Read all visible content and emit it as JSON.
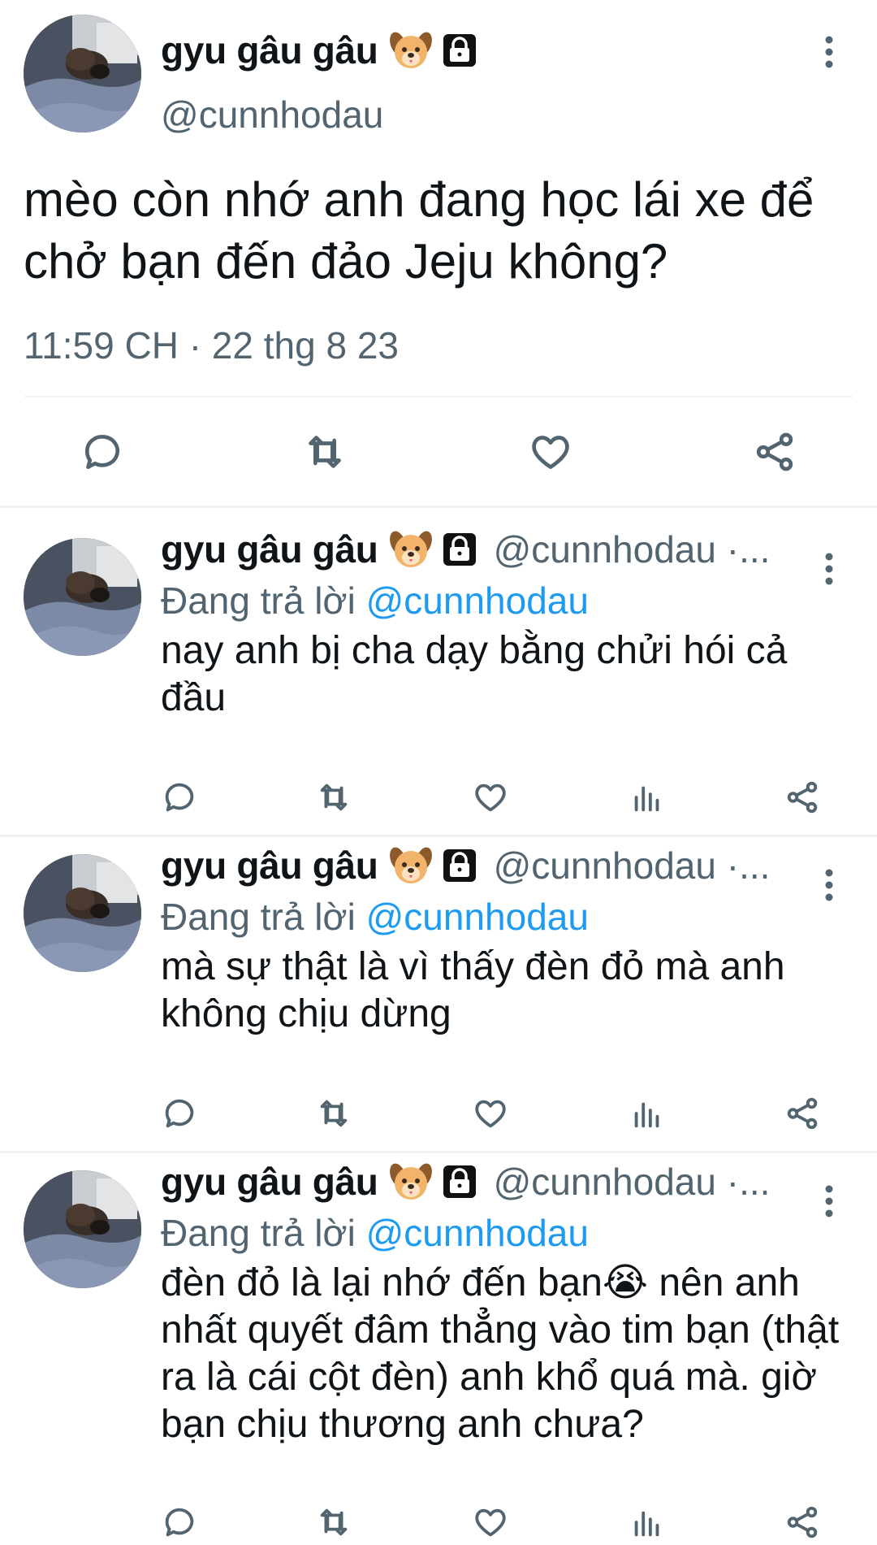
{
  "main_tweet": {
    "display_name": "gyu gâu gâu",
    "handle": "@cunnhodau",
    "text": "mèo còn nhớ anh đang học lái xe để chở bạn đến đảo Jeju không?",
    "timestamp": "11:59 CH · 22 thg 8 23",
    "icons": [
      "dog-face-emoji",
      "lock-icon",
      "more-icon",
      "reply-icon",
      "retweet-icon",
      "like-icon",
      "share-icon"
    ]
  },
  "replies": [
    {
      "display_name": "gyu gâu gâu",
      "handle_truncated": "@cunnhodau ·...",
      "replying_prefix": "Đang trả lời",
      "replying_to": "@cunnhodau",
      "text": "nay anh bị cha dạy bằng chửi hói cả đầu"
    },
    {
      "display_name": "gyu gâu gâu",
      "handle_truncated": "@cunnhodau ·...",
      "replying_prefix": "Đang trả lời",
      "replying_to": "@cunnhodau",
      "text": "mà sự thật là vì thấy đèn đỏ mà anh không chịu dừng"
    },
    {
      "display_name": "gyu gâu gâu",
      "handle_truncated": "@cunnhodau ·...",
      "replying_prefix": "Đang trả lời",
      "replying_to": "@cunnhodau",
      "text": "đèn đỏ là lại nhớ đến bạn😭 nên anh nhất quyết đâm thẳng vào tim bạn (thật ra là cái cột đèn) anh khổ quá mà. giờ bạn chịu thương anh chưa?"
    }
  ],
  "colors": {
    "text_primary": "#0f1419",
    "text_secondary": "#536471",
    "mention_blue": "#1d9bf0",
    "divider": "#eff3f4"
  }
}
